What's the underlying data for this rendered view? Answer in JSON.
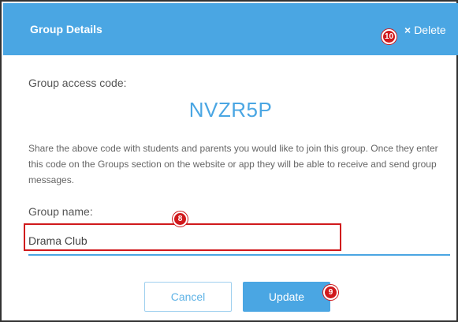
{
  "header": {
    "title": "Group Details",
    "delete_label": "Delete",
    "delete_icon": "×",
    "background_color": "#4aa6e3"
  },
  "access": {
    "label": "Group access code:",
    "code": "NVZR5P"
  },
  "description": "Share the above code with students and parents you would like to join this group. Once they enter this code on the Groups section on the website or app they will be able to receive and send group messages.",
  "group_name": {
    "label": "Group name:",
    "value": "Drama Club"
  },
  "actions": {
    "cancel_label": "Cancel",
    "update_label": "Update"
  },
  "callouts": {
    "delete_marker": "10",
    "input_marker": "8",
    "update_marker": "9",
    "color": "#d0191c"
  }
}
